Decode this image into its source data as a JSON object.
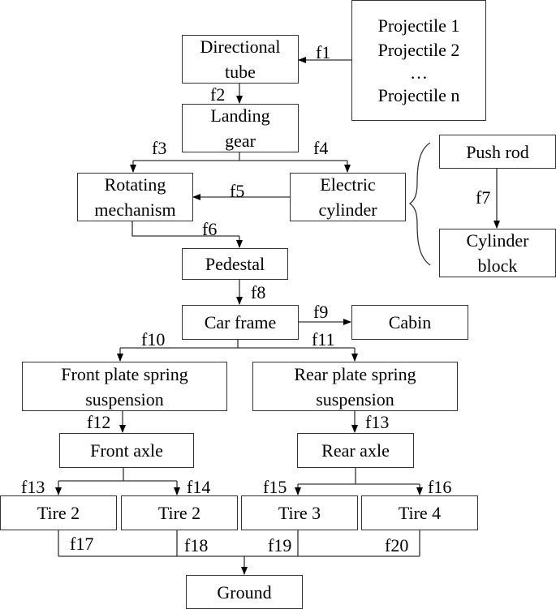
{
  "nodes": {
    "projectiles": {
      "lines": [
        "Projectile 1",
        "Projectile 2",
        "…",
        "Projectile n"
      ]
    },
    "directional_tube": {
      "lines": [
        "Directional",
        "tube"
      ]
    },
    "landing_gear": {
      "lines": [
        "Landing",
        "gear"
      ]
    },
    "rotating_mechanism": {
      "lines": [
        "Rotating",
        "mechanism"
      ]
    },
    "electric_cylinder": {
      "lines": [
        "Electric",
        "cylinder"
      ]
    },
    "push_rod": {
      "lines": [
        "Push rod"
      ]
    },
    "cylinder_block": {
      "lines": [
        "Cylinder",
        "block"
      ]
    },
    "pedestal": {
      "lines": [
        "Pedestal"
      ]
    },
    "car_frame": {
      "lines": [
        "Car frame"
      ]
    },
    "cabin": {
      "lines": [
        "Cabin"
      ]
    },
    "front_plate_spring": {
      "lines": [
        "Front plate spring",
        "suspension"
      ]
    },
    "rear_plate_spring": {
      "lines": [
        "Rear plate spring",
        "suspension"
      ]
    },
    "front_axle": {
      "lines": [
        "Front axle"
      ]
    },
    "rear_axle": {
      "lines": [
        "Rear axle"
      ]
    },
    "tire_a": {
      "lines": [
        "Tire 2"
      ]
    },
    "tire_b": {
      "lines": [
        "Tire 2"
      ]
    },
    "tire_c": {
      "lines": [
        "Tire 3"
      ]
    },
    "tire_d": {
      "lines": [
        "Tire 4"
      ]
    },
    "ground": {
      "lines": [
        "Ground"
      ]
    }
  },
  "forces": {
    "f1": "f1",
    "f2": "f2",
    "f3": "f3",
    "f4": "f4",
    "f5": "f5",
    "f6": "f6",
    "f7": "f7",
    "f8": "f8",
    "f9": "f9",
    "f10": "f10",
    "f11": "f11",
    "f12": "f12",
    "f13a": "f13",
    "f13b": "f13",
    "f14": "f14",
    "f15": "f15",
    "f16": "f16",
    "f17": "f17",
    "f18": "f18",
    "f19": "f19",
    "f20": "f20"
  },
  "colors": {
    "stroke": "#333333",
    "text": "#000000",
    "background": "#ffffff"
  }
}
